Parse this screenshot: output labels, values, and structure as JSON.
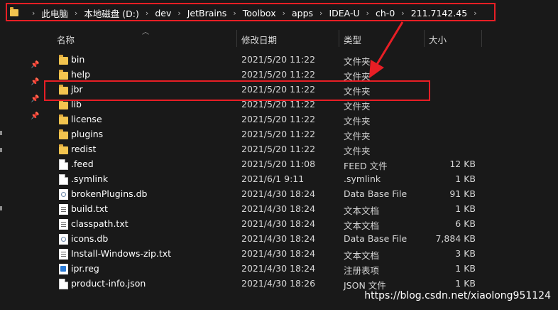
{
  "breadcrumb": [
    "此电脑",
    "本地磁盘 (D:)",
    "dev",
    "JetBrains",
    "Toolbox",
    "apps",
    "IDEA-U",
    "ch-0",
    "211.7142.45"
  ],
  "columns": {
    "name": "名称",
    "date": "修改日期",
    "type": "类型",
    "size": "大小"
  },
  "rows": [
    {
      "name": "bin",
      "date": "2021/5/20 11:22",
      "type": "文件夹",
      "size": "",
      "icon": "folder-icon"
    },
    {
      "name": "help",
      "date": "2021/5/20 11:22",
      "type": "文件夹",
      "size": "",
      "icon": "folder-icon"
    },
    {
      "name": "jbr",
      "date": "2021/5/20 11:22",
      "type": "文件夹",
      "size": "",
      "icon": "folder-icon"
    },
    {
      "name": "lib",
      "date": "2021/5/20 11:22",
      "type": "文件夹",
      "size": "",
      "icon": "folder-icon"
    },
    {
      "name": "license",
      "date": "2021/5/20 11:22",
      "type": "文件夹",
      "size": "",
      "icon": "folder-icon"
    },
    {
      "name": "plugins",
      "date": "2021/5/20 11:22",
      "type": "文件夹",
      "size": "",
      "icon": "folder-icon"
    },
    {
      "name": "redist",
      "date": "2021/5/20 11:22",
      "type": "文件夹",
      "size": "",
      "icon": "folder-icon"
    },
    {
      "name": ".feed",
      "date": "2021/5/20 11:08",
      "type": "FEED 文件",
      "size": "12 KB",
      "icon": "file-icon"
    },
    {
      "name": ".symlink",
      "date": "2021/6/1 9:11",
      "type": ".symlink",
      "size": "1 KB",
      "icon": "file-icon"
    },
    {
      "name": "brokenPlugins.db",
      "date": "2021/4/30 18:24",
      "type": "Data Base File",
      "size": "91 KB",
      "icon": "database-file-icon"
    },
    {
      "name": "build.txt",
      "date": "2021/4/30 18:24",
      "type": "文本文档",
      "size": "1 KB",
      "icon": "text-file-icon"
    },
    {
      "name": "classpath.txt",
      "date": "2021/4/30 18:24",
      "type": "文本文档",
      "size": "6 KB",
      "icon": "text-file-icon"
    },
    {
      "name": "icons.db",
      "date": "2021/4/30 18:24",
      "type": "Data Base File",
      "size": "7,884 KB",
      "icon": "database-file-icon"
    },
    {
      "name": "Install-Windows-zip.txt",
      "date": "2021/4/30 18:24",
      "type": "文本文档",
      "size": "3 KB",
      "icon": "text-file-icon"
    },
    {
      "name": "ipr.reg",
      "date": "2021/4/30 18:24",
      "type": "注册表项",
      "size": "1 KB",
      "icon": "registry-file-icon"
    },
    {
      "name": "product-info.json",
      "date": "2021/4/30 18:26",
      "type": "JSON 文件",
      "size": "1 KB",
      "icon": "file-icon"
    }
  ],
  "watermark": "https://blog.csdn.net/xiaolong951124",
  "colors": {
    "background": "#191919",
    "annotation_red": "#e81e25",
    "folder": "#f3c44f"
  }
}
